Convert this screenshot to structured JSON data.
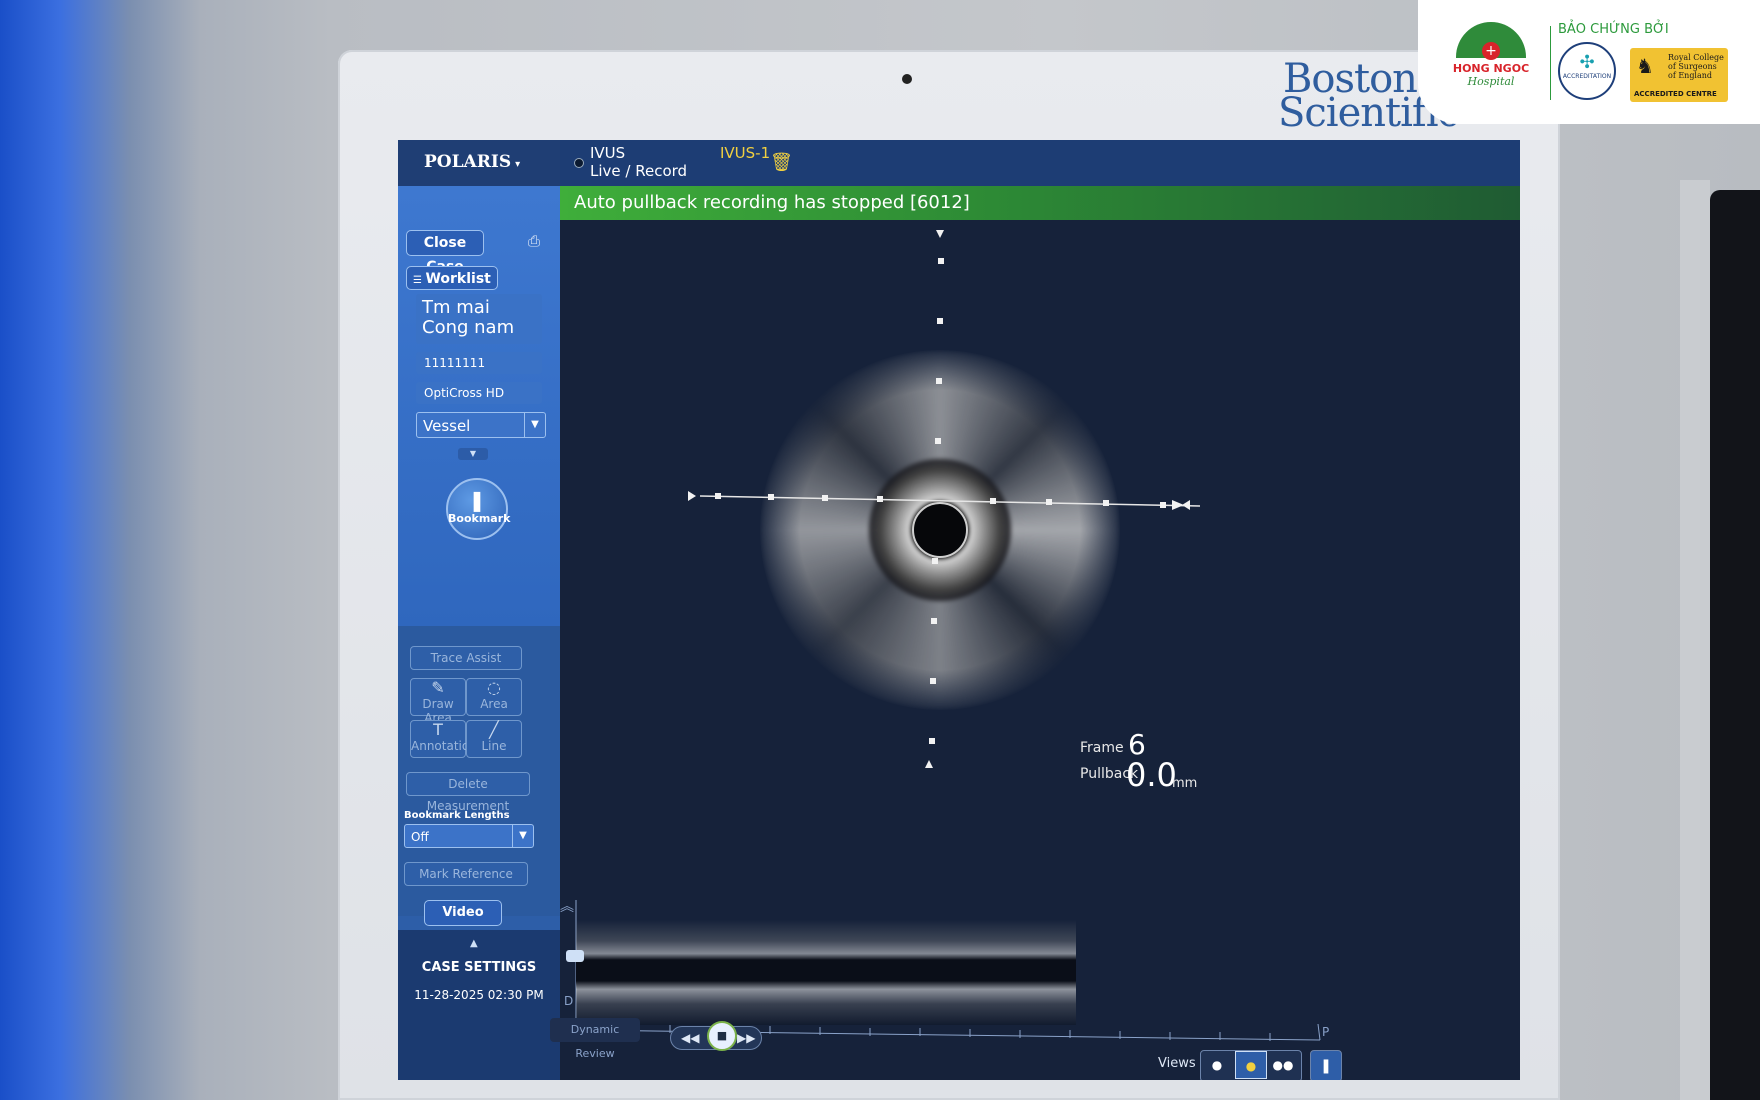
{
  "brand": {
    "line1": "Boston",
    "line2": "Scientific"
  },
  "app": {
    "name": "POLARIS",
    "caret": "▾"
  },
  "header": {
    "mode_line1": "IVUS",
    "mode_line2": "Live / Record",
    "run_label": "IVUS-1"
  },
  "banner": {
    "message": "Auto pullback recording has stopped [6012]"
  },
  "sidebar": {
    "close_case": "Close Case",
    "worklist": "Worklist",
    "patient_line1": "Tm mai",
    "patient_line2": "Cong nam",
    "patient_id": "11111111",
    "catheter": "OptiCross HD",
    "vessel_select": "Vessel",
    "bookmark": "Bookmark",
    "trace_assist": "Trace Assist",
    "draw_area": "Draw Area",
    "area": "Area",
    "annotation": "Annotation",
    "line": "Line",
    "delete_measurement": "Delete Measurement",
    "bookmark_lengths_label": "Bookmark Lengths",
    "bookmark_lengths_value": "Off",
    "mark_reference": "Mark Reference",
    "video_help": "Video Help",
    "case_settings": "CASE SETTINGS",
    "datetime": "11-28-2025 02:30 PM"
  },
  "readout": {
    "frame_label": "Frame",
    "frame_value": "6",
    "pullback_label": "Pullback",
    "pullback_value": "0.0",
    "pullback_unit": "mm"
  },
  "longitudinal": {
    "distal_label": "D",
    "proximal_label": "P",
    "dynamic_review": "Dynamic Review"
  },
  "views": {
    "label": "Views"
  },
  "corner_logos": {
    "title": "BẢO CHỨNG BỞI",
    "hospital_name": "HONG NGOC",
    "hospital_sub": "Hospital",
    "aci_text": "ACCREDITATION",
    "rcs_text": "Royal College of Surgeons of England",
    "rcs_badge": "ACCREDITED CENTRE"
  },
  "colors": {
    "banner_green": "#3fae3a",
    "run_label_yellow": "#f1d040",
    "sidebar_blue": "#2d5ea8"
  }
}
